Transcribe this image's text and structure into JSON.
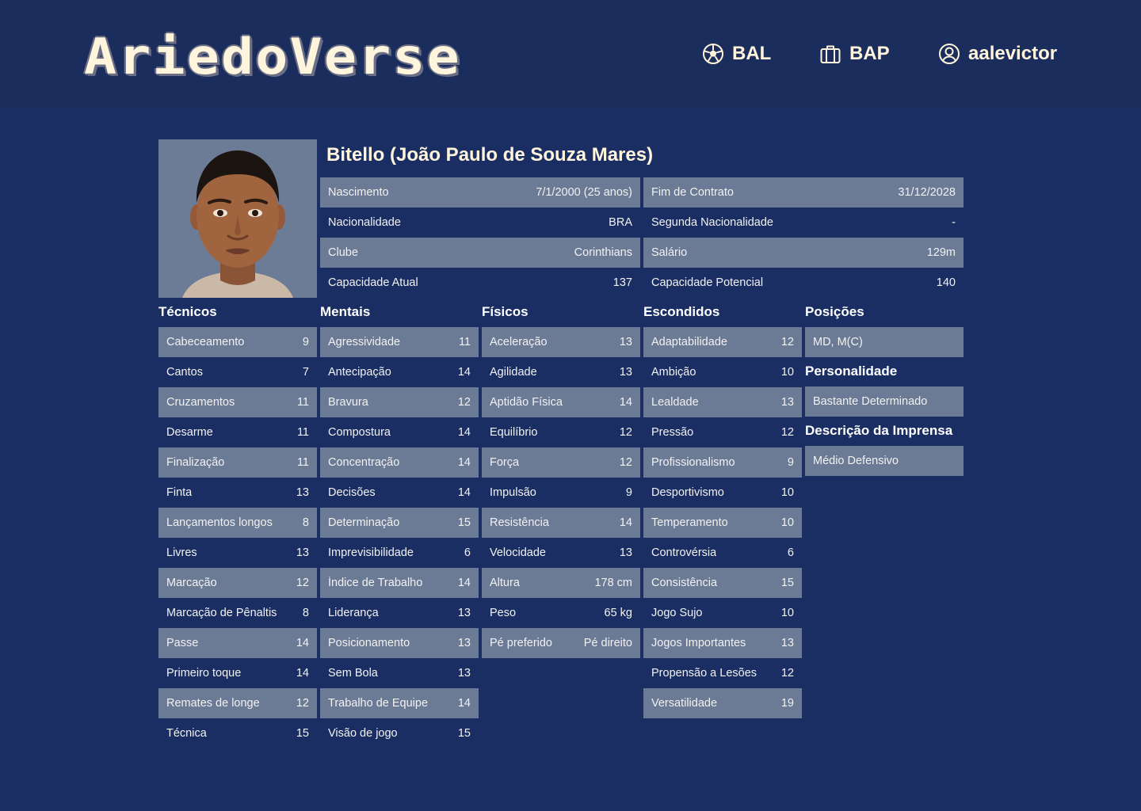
{
  "header": {
    "logo": "AriedoVerse",
    "nav": [
      {
        "label": "BAL",
        "icon": "soccer-ball-icon"
      },
      {
        "label": "BAP",
        "icon": "briefcase-icon"
      },
      {
        "label": "aalevictor",
        "icon": "user-circle-icon"
      }
    ]
  },
  "player": {
    "name": "Bitello (João Paulo de Souza Mares)",
    "info_left": [
      {
        "label": "Nascimento",
        "value": "7/1/2000 (25 anos)"
      },
      {
        "label": "Nacionalidade",
        "value": "BRA"
      },
      {
        "label": "Clube",
        "value": "Corinthians"
      },
      {
        "label": "Capacidade Atual",
        "value": "137"
      }
    ],
    "info_right": [
      {
        "label": "Fim de Contrato",
        "value": "31/12/2028"
      },
      {
        "label": "Segunda Nacionalidade",
        "value": "-"
      },
      {
        "label": "Salário",
        "value": "129m"
      },
      {
        "label": "Capacidade Potencial",
        "value": "140"
      }
    ]
  },
  "sections": {
    "tecnicos": {
      "title": "Técnicos",
      "items": [
        {
          "label": "Cabeceamento",
          "value": "9"
        },
        {
          "label": "Cantos",
          "value": "7"
        },
        {
          "label": "Cruzamentos",
          "value": "11"
        },
        {
          "label": "Desarme",
          "value": "11"
        },
        {
          "label": "Finalização",
          "value": "11"
        },
        {
          "label": "Finta",
          "value": "13"
        },
        {
          "label": "Lançamentos longos",
          "value": "8"
        },
        {
          "label": "Livres",
          "value": "13"
        },
        {
          "label": "Marcação",
          "value": "12"
        },
        {
          "label": "Marcação de Pênaltis",
          "value": "8"
        },
        {
          "label": "Passe",
          "value": "14"
        },
        {
          "label": "Primeiro toque",
          "value": "14"
        },
        {
          "label": "Remates de longe",
          "value": "12"
        },
        {
          "label": "Técnica",
          "value": "15"
        }
      ]
    },
    "mentais": {
      "title": "Mentais",
      "items": [
        {
          "label": "Agressividade",
          "value": "11"
        },
        {
          "label": "Antecipação",
          "value": "14"
        },
        {
          "label": "Bravura",
          "value": "12"
        },
        {
          "label": "Compostura",
          "value": "14"
        },
        {
          "label": "Concentração",
          "value": "14"
        },
        {
          "label": "Decisões",
          "value": "14"
        },
        {
          "label": "Determinação",
          "value": "15"
        },
        {
          "label": "Imprevisibilidade",
          "value": "6"
        },
        {
          "label": "Índice de Trabalho",
          "value": "14"
        },
        {
          "label": "Liderança",
          "value": "13"
        },
        {
          "label": "Posicionamento",
          "value": "13"
        },
        {
          "label": "Sem Bola",
          "value": "13"
        },
        {
          "label": "Trabalho de Equipe",
          "value": "14"
        },
        {
          "label": "Visão de jogo",
          "value": "15"
        }
      ]
    },
    "fisicos": {
      "title": "Físicos",
      "items": [
        {
          "label": "Aceleração",
          "value": "13"
        },
        {
          "label": "Agilidade",
          "value": "13"
        },
        {
          "label": "Aptidão Física",
          "value": "14"
        },
        {
          "label": "Equilíbrio",
          "value": "12"
        },
        {
          "label": "Força",
          "value": "12"
        },
        {
          "label": "Impulsão",
          "value": "9"
        },
        {
          "label": "Resistência",
          "value": "14"
        },
        {
          "label": "Velocidade",
          "value": "13"
        },
        {
          "label": "Altura",
          "value": "178 cm"
        },
        {
          "label": "Peso",
          "value": "65 kg"
        },
        {
          "label": "Pé preferido",
          "value": "Pé direito"
        }
      ]
    },
    "escondidos": {
      "title": "Escondidos",
      "items": [
        {
          "label": "Adaptabilidade",
          "value": "12"
        },
        {
          "label": "Ambição",
          "value": "10"
        },
        {
          "label": "Lealdade",
          "value": "13"
        },
        {
          "label": "Pressão",
          "value": "12"
        },
        {
          "label": "Profissionalismo",
          "value": "9"
        },
        {
          "label": "Desportivismo",
          "value": "10"
        },
        {
          "label": "Temperamento",
          "value": "10"
        },
        {
          "label": "Controvérsia",
          "value": "6"
        },
        {
          "label": "Consistência",
          "value": "15"
        },
        {
          "label": "Jogo Sujo",
          "value": "10"
        },
        {
          "label": "Jogos Importantes",
          "value": "13"
        },
        {
          "label": "Propensão a Lesões",
          "value": "12"
        },
        {
          "label": "Versatilidade",
          "value": "19"
        }
      ]
    },
    "posicoes": {
      "title": "Posições",
      "value": "MD, M(C)"
    },
    "personalidade": {
      "title": "Personalidade",
      "value": "Bastante Determinado"
    },
    "imprensa": {
      "title": "Descrição da Imprensa",
      "value": "Médio Defensivo"
    }
  },
  "colors": {
    "background": "#1a2e63",
    "header": "#1b2d5c",
    "row_shade": "#6b7a95",
    "accent_text": "#fff5dc"
  }
}
